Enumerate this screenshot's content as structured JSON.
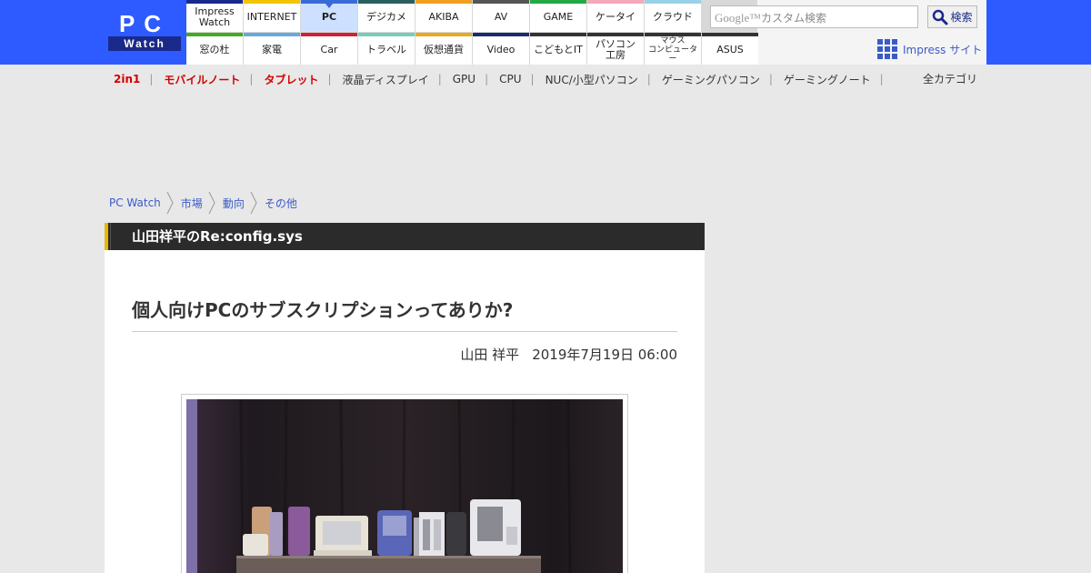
{
  "logo": {
    "top": "PC",
    "bottom": "Watch"
  },
  "nav": {
    "row1": [
      {
        "label": "Impress\nWatch",
        "color": "#1a2a8a"
      },
      {
        "label": "INTERNET",
        "color": "#f2c400"
      },
      {
        "label": "PC",
        "color": "#3a6ad8",
        "active": true
      },
      {
        "label": "デジカメ",
        "color": "#2b5f5f"
      },
      {
        "label": "AKIBA",
        "color": "#f0a020"
      },
      {
        "label": "AV",
        "color": "#555555"
      },
      {
        "label": "GAME",
        "color": "#22aa44"
      },
      {
        "label": "ケータイ",
        "color": "#f4a8b8"
      },
      {
        "label": "クラウド",
        "color": "#9ad0e8"
      }
    ],
    "row2": [
      {
        "label": "窓の杜",
        "color": "#44aa22"
      },
      {
        "label": "家電",
        "color": "#66aadd"
      },
      {
        "label": "Car",
        "color": "#cc2233"
      },
      {
        "label": "トラベル",
        "color": "#77ccbb"
      },
      {
        "label": "仮想通貨",
        "color": "#e8a820"
      },
      {
        "label": "Video",
        "color": "#1a2a6a"
      },
      {
        "label": "こどもとIT",
        "color": "#333333"
      },
      {
        "label": "パソコン\n工房",
        "color": "#333333"
      },
      {
        "label": "マウス\nコンピューター",
        "color": "#333333"
      },
      {
        "label": "ASUS",
        "color": "#333333"
      }
    ]
  },
  "search": {
    "google": "Google™",
    "placeholder": "カスタム検索",
    "button": "検索"
  },
  "impress_site": "Impress サイト",
  "categories": [
    {
      "label": "2in1",
      "red": true
    },
    {
      "label": "モバイルノート",
      "red": true
    },
    {
      "label": "タブレット",
      "red": true
    },
    {
      "label": "液晶ディスプレイ",
      "red": false
    },
    {
      "label": "GPU",
      "red": false
    },
    {
      "label": "CPU",
      "red": false
    },
    {
      "label": "NUC/小型パソコン",
      "red": false
    },
    {
      "label": "ゲーミングパソコン",
      "red": false
    },
    {
      "label": "ゲーミングノート",
      "red": false
    }
  ],
  "all_categories": "全カテゴリ",
  "breadcrumb": [
    "PC Watch",
    "市場",
    "動向",
    "その他"
  ],
  "article": {
    "series": "山田祥平のRe:config.sys",
    "headline": "個人向けPCのサブスクリプションってありか?",
    "author": "山田 祥平",
    "date": "2019年7月19日 06:00"
  }
}
